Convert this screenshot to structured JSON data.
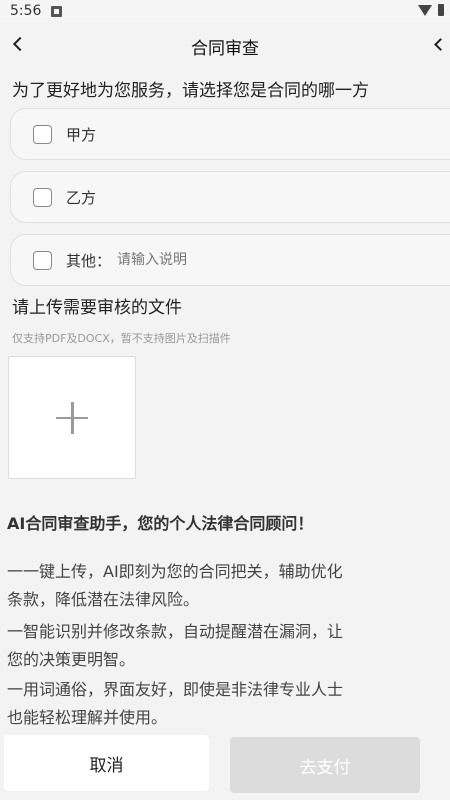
{
  "status_bar": {
    "time": "5:56"
  },
  "header": {
    "title": "合同审查"
  },
  "role_question": "为了更好地为您服务，请选择您是合同的哪一方",
  "options": [
    {
      "label": "甲方"
    },
    {
      "label": "乙方"
    },
    {
      "label": "其他：",
      "placeholder": "请输入说明"
    }
  ],
  "upload": {
    "title": "请上传需要审核的文件",
    "hint": "仅支持PDF及DOCX，暂不支持图片及扫描件"
  },
  "promo": {
    "title": "AI合同审查助手，您的个人法律合同顾问！",
    "lines": [
      "一一键上传，AI即刻为您的合同把关，辅助优化",
      "条款，降低潜在法律风险。",
      "一智能识别并修改条款，自动提醒潜在漏洞，让",
      "您的决策更明智。",
      "一用词通俗，界面友好，即使是非法律专业人士",
      "也能轻松理解并使用。"
    ]
  },
  "footer": {
    "cancel_label": "取消",
    "pay_label": "去支付"
  }
}
